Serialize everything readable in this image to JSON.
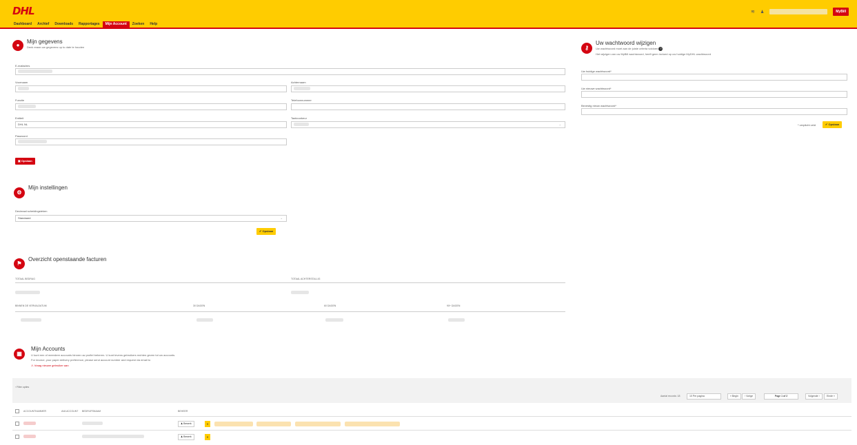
{
  "header": {
    "logo": "DHL",
    "nav": [
      "Dashboard",
      "Archief",
      "Downloads",
      "Rapportages",
      "Mijn Account",
      "Zoeken",
      "Help"
    ],
    "active_nav": "Mijn Account",
    "mydhl_label": "MyBill"
  },
  "gegevens": {
    "title": "Mijn gegevens",
    "subtitle": "Denk eraan uw gegevens up to date te houden",
    "email_label": "E-mailadres",
    "voornaam_label": "Voornaam",
    "achternaam_label": "Achternaam",
    "functie_label": "Functie",
    "telefoon_label": "Telefoonnummer",
    "entiteit_label": "Entiteit",
    "entiteit_value": "DHL NL",
    "taal_label": "Taalvoorkeur",
    "paswoord_label": "Paswoord",
    "opslaan_label": "Opslaan"
  },
  "wachtwoord": {
    "title": "Uw wachtwoord wijzigen",
    "sub1": "Uw wachtwoord moet aan de juiste criteria voldoen",
    "sub2": "Het wijzigen van uw MyBill wachtwoord, heeft geen invloed op uw huidige MyDHL wachtwoord",
    "huidig_label": "Uw huidige wachtwoord*",
    "nieuw_label": "Uw nieuwe wachtwoord*",
    "bevestig_label": "Bevestig nieuw wachtwoord*",
    "verplicht_label": "* verplicht veld",
    "opslaan_label": "Opslaan"
  },
  "instellingen": {
    "title": "Mijn instellingen",
    "decimal_label": "Decimaal scheidingsteken",
    "decimal_value": "Standaard",
    "opslaan_label": "Opslaan"
  },
  "facturen": {
    "title": "Overzicht openstaande facturen",
    "col1": "Totaal bedrag",
    "col2": "Totaal achterstallig",
    "col3": "Binnen de vervaldatum",
    "col4": "30 dagen",
    "col5": "60 dagen",
    "col6": "90+ dagen"
  },
  "accounts": {
    "title": "Mijn Accounts",
    "line1": "U kunt een of meerdere accounts binnen uw profiel beheren. U kunt tevens gebruikers rechten geven tot uw accounts.",
    "line2": "For invoice, your paper delivery preference, please send account number and request via email to",
    "link": "Vraag nieuwe gebruiker aan",
    "filter_label": "Filter opties",
    "records_label": "Aantal records: 18",
    "per_page": "10 Per pagina",
    "begin": "« Begin",
    "vorige": "‹ Vorige",
    "page": "Page 1 of 2",
    "volgende": "Volgende ›",
    "einde": "Einde »",
    "col_account": "Accountnummer",
    "col_ava": "AVA Account",
    "col_bedrijf": "Bedrijfsnaam",
    "col_beheer": "Beheer",
    "bewerken": "Bewerk"
  }
}
